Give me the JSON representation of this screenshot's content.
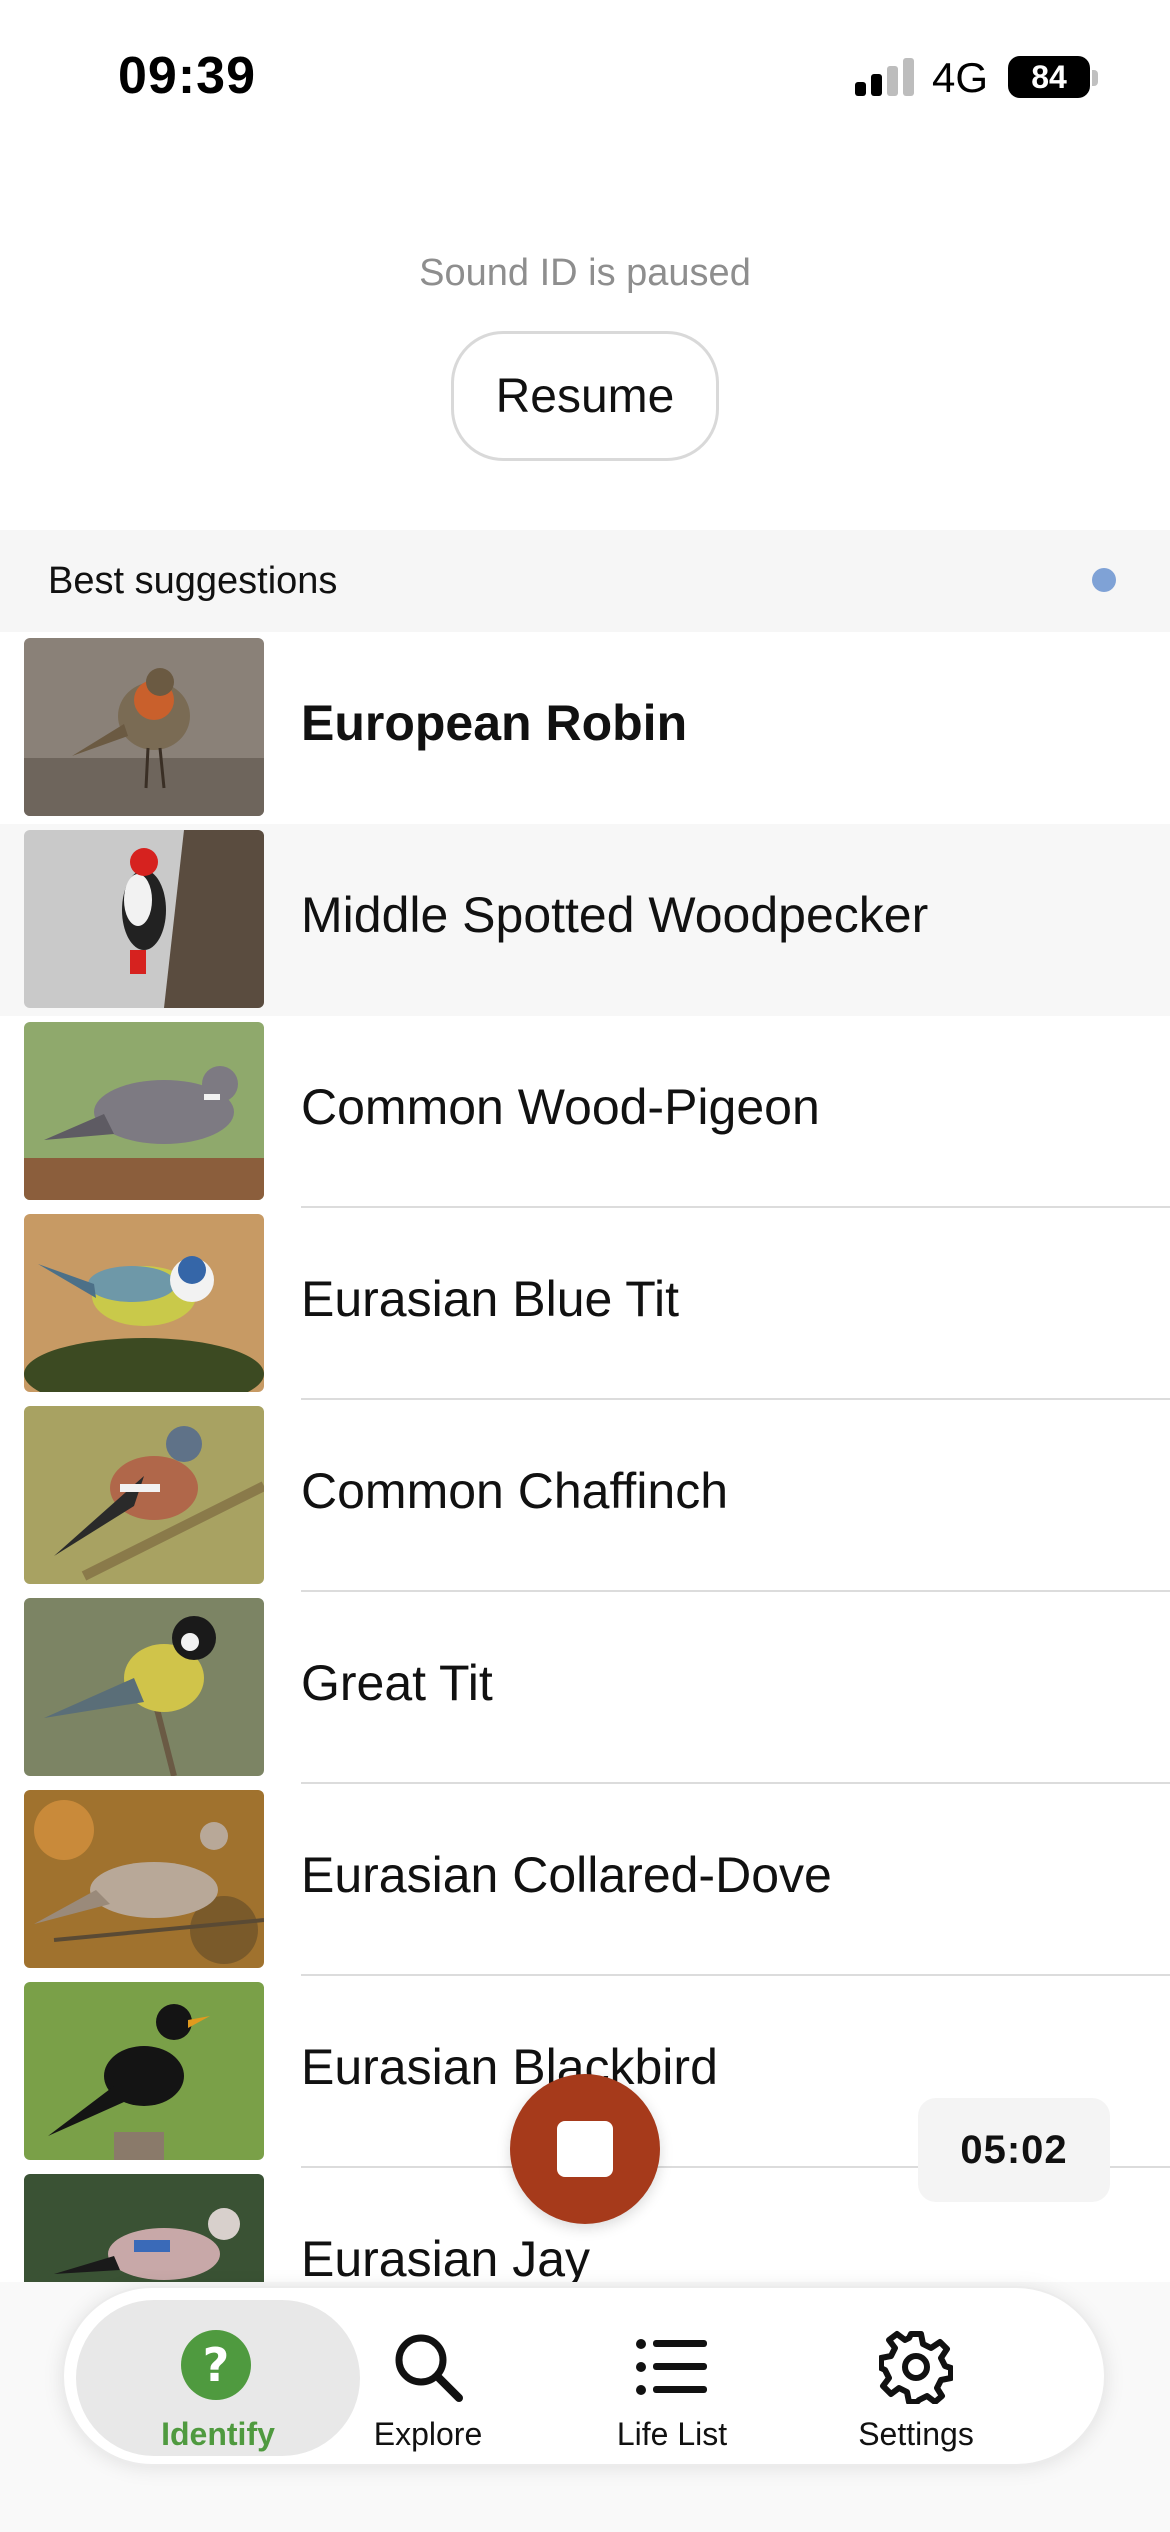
{
  "status_bar": {
    "time": "09:39",
    "network": "4G",
    "battery": "84"
  },
  "sound_id": {
    "status_text": "Sound ID is paused",
    "resume_label": "Resume"
  },
  "suggestions": {
    "title": "Best suggestions",
    "items": [
      {
        "name": "European Robin",
        "bold": true,
        "icon": "european-robin-photo"
      },
      {
        "name": "Middle Spotted Woodpecker",
        "bold": false,
        "icon": "woodpecker-photo"
      },
      {
        "name": "Common Wood-Pigeon",
        "bold": false,
        "icon": "wood-pigeon-photo"
      },
      {
        "name": "Eurasian Blue Tit",
        "bold": false,
        "icon": "blue-tit-photo"
      },
      {
        "name": "Common Chaffinch",
        "bold": false,
        "icon": "chaffinch-photo"
      },
      {
        "name": "Great Tit",
        "bold": false,
        "icon": "great-tit-photo"
      },
      {
        "name": "Eurasian Collared-Dove",
        "bold": false,
        "icon": "collared-dove-photo"
      },
      {
        "name": "Eurasian Blackbird",
        "bold": false,
        "icon": "blackbird-photo"
      },
      {
        "name": "Eurasian Jay",
        "bold": false,
        "icon": "jay-photo"
      }
    ]
  },
  "recording": {
    "timer": "05:02",
    "stop_color": "#a63a1b"
  },
  "tab_bar": {
    "identify": "Identify",
    "explore": "Explore",
    "life_list": "Life List",
    "settings": "Settings",
    "accent": "#4f9a3f"
  }
}
